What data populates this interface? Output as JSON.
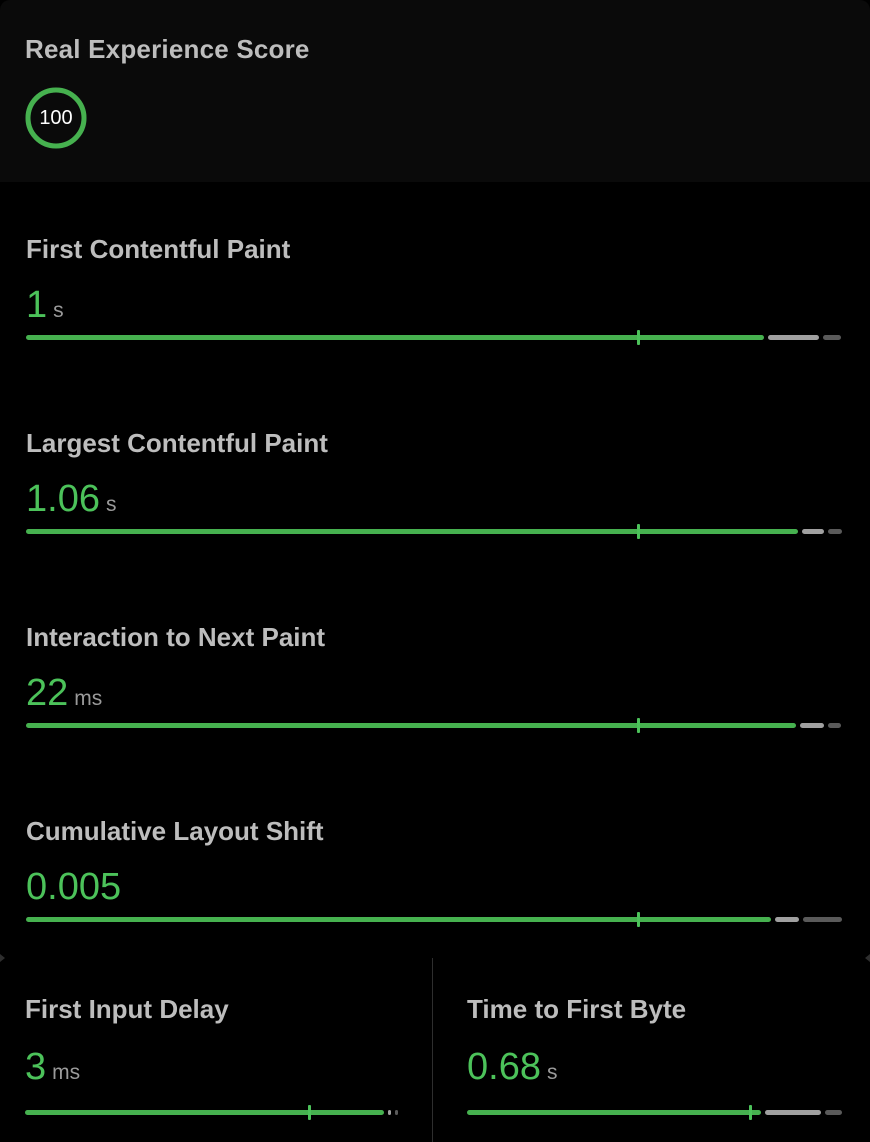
{
  "score": {
    "title": "Real Experience Score",
    "value": "100",
    "fraction": 1.0,
    "ring_color": "#46b14f"
  },
  "metrics": [
    {
      "label": "First Contentful Paint",
      "value": "1",
      "unit": "s",
      "segments": {
        "good": 0.907,
        "mid": 0.062,
        "poor": 0.023
      },
      "marker": 0.752
    },
    {
      "label": "Largest Contentful Paint",
      "value": "1.06",
      "unit": "s",
      "segments": {
        "good": 0.948,
        "mid": 0.027,
        "poor": 0.018
      },
      "marker": 0.752
    },
    {
      "label": "Interaction to Next Paint",
      "value": "22",
      "unit": "ms",
      "segments": {
        "good": 0.946,
        "mid": 0.03,
        "poor": 0.015
      },
      "marker": 0.752
    },
    {
      "label": "Cumulative Layout Shift",
      "value": "0.005",
      "unit": "",
      "segments": {
        "good": 0.915,
        "mid": 0.03,
        "poor": 0.048
      },
      "marker": 0.752
    }
  ],
  "half_metrics": [
    {
      "label": "First Input Delay",
      "value": "3",
      "unit": "ms",
      "segments": {
        "good": 0.955,
        "mid": 0.008,
        "poor": 0.008
      },
      "marker": 0.755
    },
    {
      "label": "Time to First Byte",
      "value": "0.68",
      "unit": "s",
      "segments": {
        "good": 0.788,
        "mid": 0.15,
        "poor": 0.047
      },
      "marker": 0.76
    }
  ],
  "colors": {
    "good": "#46b14f",
    "needs_improvement": "#a0a0a0",
    "poor": "#5a5a5a",
    "value_text": "#4cc25a"
  }
}
